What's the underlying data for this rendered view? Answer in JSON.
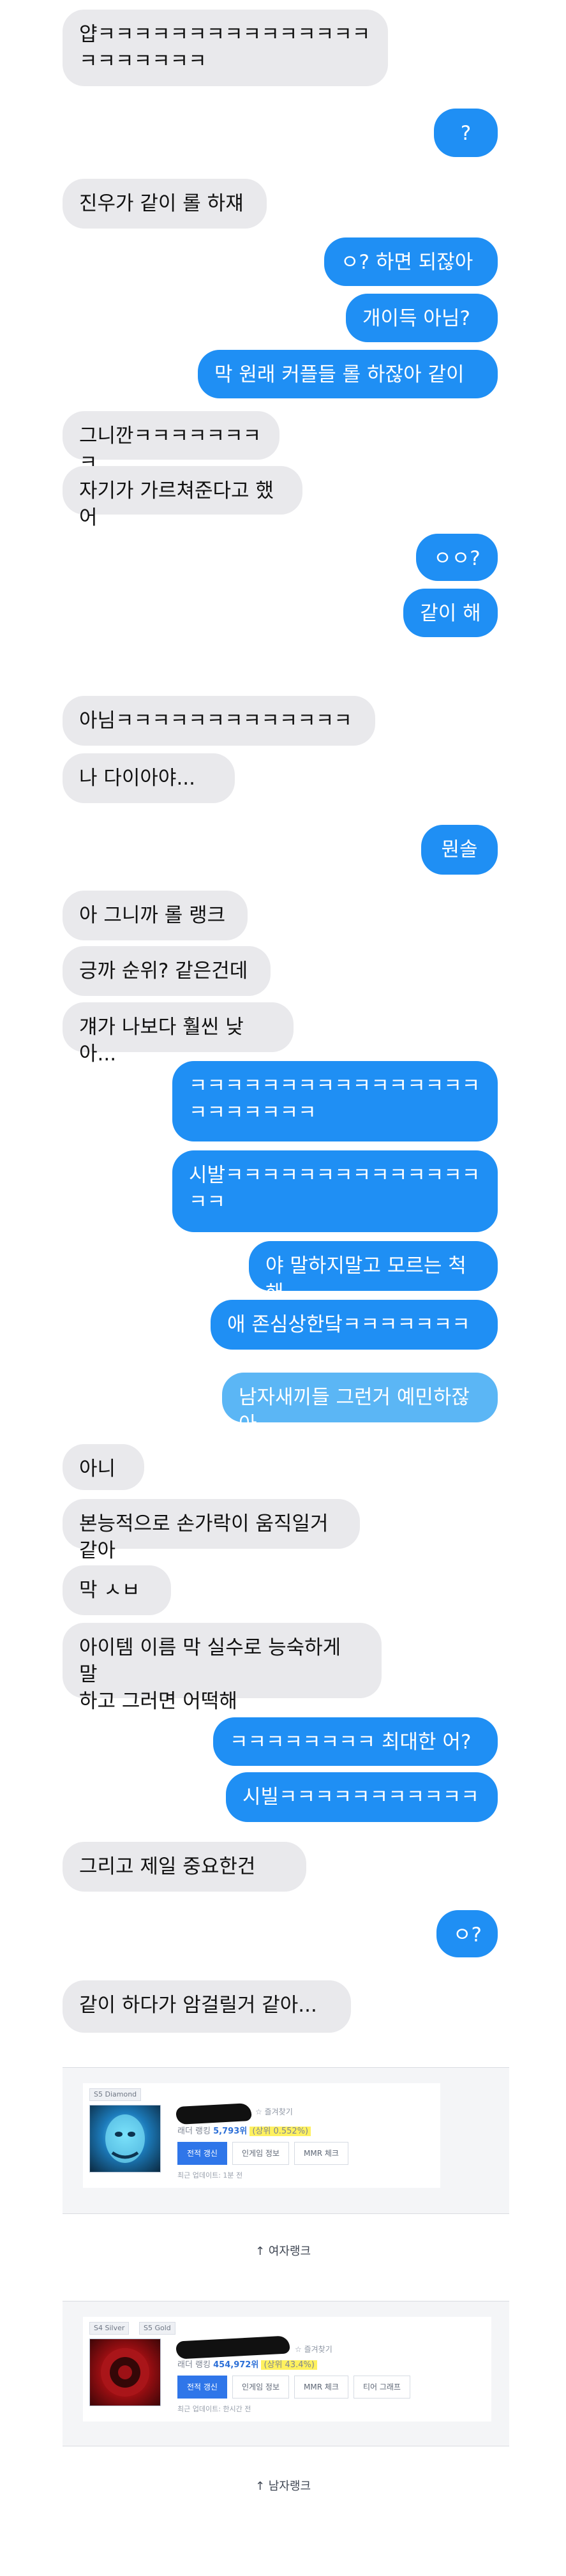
{
  "chat": {
    "messages": [
      {
        "side": "in",
        "text": "얍ㅋㅋㅋㅋㅋㅋㅋㅋㅋㅋㅋㅋㅋㅋㅋ\nㅋㅋㅋㅋㅋㅋㅋ"
      },
      {
        "side": "out",
        "text": "?"
      },
      {
        "side": "in",
        "text": "진우가 같이 롤 하쟤"
      },
      {
        "side": "out",
        "text": "ㅇ? 하면 되잖아"
      },
      {
        "side": "out",
        "text": "개이득 아님?"
      },
      {
        "side": "out",
        "text": "막 원래 커플들 롤 하잖아 같이"
      },
      {
        "side": "in",
        "text": "그니깐ㅋㅋㅋㅋㅋㅋㅋㅋ"
      },
      {
        "side": "in",
        "text": "자기가 가르쳐준다고 했어"
      },
      {
        "side": "out",
        "text": "ㅇㅇ?"
      },
      {
        "side": "out",
        "text": "같이 해"
      },
      {
        "side": "in",
        "text": "아님ㅋㅋㅋㅋㅋㅋㅋㅋㅋㅋㅋㅋㅋ"
      },
      {
        "side": "in",
        "text": "나 다이아야..."
      },
      {
        "side": "out",
        "text": "뭔솔"
      },
      {
        "side": "in",
        "text": "아 그니까 롤 랭크"
      },
      {
        "side": "in",
        "text": "긍까 순위? 같은건데"
      },
      {
        "side": "in",
        "text": "걔가 나보다 훨씬 낮아..."
      },
      {
        "side": "out",
        "text": "ㅋㅋㅋㅋㅋㅋㅋㅋㅋㅋㅋㅋㅋㅋㅋㅋ\nㅋㅋㅋㅋㅋㅋㅋ"
      },
      {
        "side": "out",
        "text": "시발ㅋㅋㅋㅋㅋㅋㅋㅋㅋㅋㅋㅋㅋㅋ\nㅋㅋ"
      },
      {
        "side": "out",
        "text": "야 말하지말고 모르는 척 해"
      },
      {
        "side": "out",
        "text": "애 존심상한닼ㅋㅋㅋㅋㅋㅋㅋ"
      },
      {
        "side": "out",
        "text": "남자새끼들 그런거 예민하잖아"
      },
      {
        "side": "in",
        "text": "아니"
      },
      {
        "side": "in",
        "text": "본능적으로 손가락이 움직일거 같아"
      },
      {
        "side": "in",
        "text": "막 ㅅㅂ"
      },
      {
        "side": "in",
        "text": "아이템 이름 막 실수로 능숙하게 말\n하고 그러면 어떡해"
      },
      {
        "side": "out",
        "text": "ㅋㅋㅋㅋㅋㅋㅋㅋ 최대한 어?"
      },
      {
        "side": "out",
        "text": "시빌ㅋㅋㅋㅋㅋㅋㅋㅋㅋㅋㅋ"
      },
      {
        "side": "in",
        "text": "그리고 제일 중요한건"
      },
      {
        "side": "out",
        "text": "ㅇ?"
      },
      {
        "side": "in",
        "text": "같이 하다가 암걸릴거 같아..."
      }
    ]
  },
  "rank_cards": [
    {
      "tiers": [
        "S5 Diamond"
      ],
      "level": "30",
      "favorite": "☆ 즐겨찾기",
      "rank_prefix": "래더 랭킹",
      "rank_number": "5,793위",
      "rank_percent": "(상위 0.552%)",
      "buttons": [
        "전적 갱신",
        "인게임 정보",
        "MMR 체크"
      ],
      "updated": "최근 업데이트: 1분 전",
      "caption": "↑ 여자랭크"
    },
    {
      "tiers": [
        "S4 Silver",
        "S5 Gold"
      ],
      "level": "30",
      "favorite": "☆ 즐겨찾기",
      "rank_prefix": "래더 랭킹",
      "rank_number": "454,972위",
      "rank_percent": "(상위 43.4%)",
      "buttons": [
        "전적 갱신",
        "인게임 정보",
        "MMR 체크",
        "티어 그래프"
      ],
      "updated": "최근 업데이트: 한시간 전",
      "caption": "↑ 남자랭크"
    }
  ],
  "colors": {
    "incoming_bubble": "#e9e9ec",
    "outgoing_bubble": "#1f8ff4",
    "outgoing_bubble_light": "#5bb6f5",
    "primary_button": "#2f76e9",
    "rank_highlight": "#fff15e"
  }
}
